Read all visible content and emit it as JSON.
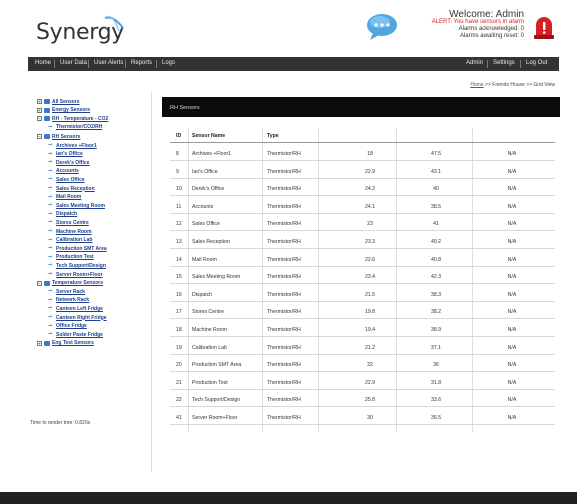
{
  "header": {
    "logo_text": "Synergy",
    "welcome": "Welcome: Admin",
    "alert": "ALERT: You have sensors in alarm",
    "alarms_ack": "Alarms acknowledged: 0",
    "alarms_waiting": "Alarms awaiting reset: 0"
  },
  "nav": {
    "left": [
      "Home",
      "User Data",
      "User Alerts",
      "Reports",
      "Logs"
    ],
    "right": [
      "Admin",
      "Settings",
      "Log Out"
    ],
    "active": "User Data"
  },
  "breadcrumb": {
    "home": "Home",
    "rest": ">> Friends House >> Grid View"
  },
  "sidebar": {
    "items": [
      {
        "label": "All Sensors",
        "level": 0,
        "kind": "box"
      },
      {
        "label": "Energy Sensors",
        "level": 0,
        "kind": "box"
      },
      {
        "label": "RH - Temperature - CO2",
        "level": 0,
        "kind": "box"
      },
      {
        "label": "Thermistor/CO2/RH",
        "level": 1,
        "kind": "sensor"
      },
      {
        "label": "RH Sensors",
        "level": 0,
        "kind": "box"
      },
      {
        "label": "Archives +Floor1",
        "level": 1,
        "kind": "sensor"
      },
      {
        "label": "Ian's Office",
        "level": 1,
        "kind": "sensor"
      },
      {
        "label": "Derek's Office",
        "level": 1,
        "kind": "sensor"
      },
      {
        "label": "Accounts",
        "level": 1,
        "kind": "sensor"
      },
      {
        "label": "Sales Office",
        "level": 1,
        "kind": "sensor"
      },
      {
        "label": "Sales Reception",
        "level": 1,
        "kind": "sensor"
      },
      {
        "label": "Mail Room",
        "level": 1,
        "kind": "sensor"
      },
      {
        "label": "Sales Meeting Room",
        "level": 1,
        "kind": "sensor"
      },
      {
        "label": "Dispatch",
        "level": 1,
        "kind": "sensor"
      },
      {
        "label": "Stores Centre",
        "level": 1,
        "kind": "sensor"
      },
      {
        "label": "Machine Room",
        "level": 1,
        "kind": "sensor"
      },
      {
        "label": "Calibration Lab",
        "level": 1,
        "kind": "sensor"
      },
      {
        "label": "Production SMT Area",
        "level": 1,
        "kind": "sensor"
      },
      {
        "label": "Production Test",
        "level": 1,
        "kind": "sensor"
      },
      {
        "label": "Tech Support/Design",
        "level": 1,
        "kind": "sensor"
      },
      {
        "label": "Server Room+Floor",
        "level": 1,
        "kind": "sensor"
      },
      {
        "label": "Temperature Sensors",
        "level": 0,
        "kind": "box"
      },
      {
        "label": "Server Rack",
        "level": 1,
        "kind": "sensor"
      },
      {
        "label": "Network Rack",
        "level": 1,
        "kind": "sensor"
      },
      {
        "label": "Canteen Left Fridge",
        "level": 1,
        "kind": "sensor"
      },
      {
        "label": "Canteen Right Fridge",
        "level": 1,
        "kind": "sensor"
      },
      {
        "label": "Office Fridge",
        "level": 1,
        "kind": "sensor"
      },
      {
        "label": "Solder Paste Fridge",
        "level": 1,
        "kind": "sensor"
      },
      {
        "label": "Eng Test Sensors",
        "level": 0,
        "kind": "box"
      }
    ],
    "time_note": "Time to render tree: 0.820s"
  },
  "panel": {
    "title": "RH Sensors",
    "columns": [
      "ID",
      "Sensor Name",
      "Type",
      "",
      "",
      ""
    ],
    "rows": [
      [
        "8",
        "Archives +Floor1",
        "Thermistor/RH",
        "18",
        "47.5",
        "N/A"
      ],
      [
        "9",
        "Ian's Office",
        "Thermistor/RH",
        "22.9",
        "43.1",
        "N/A"
      ],
      [
        "10",
        "Derek's Office",
        "Thermistor/RH",
        "24.2",
        "40",
        "N/A"
      ],
      [
        "11",
        "Accounts",
        "Thermistor/RH",
        "24.1",
        "38.5",
        "N/A"
      ],
      [
        "12",
        "Sales Office",
        "Thermistor/RH",
        "23",
        "41",
        "N/A"
      ],
      [
        "13",
        "Sales Reception",
        "Thermistor/RH",
        "23.3",
        "40.2",
        "N/A"
      ],
      [
        "14",
        "Mail Room",
        "Thermistor/RH",
        "22.6",
        "40.8",
        "N/A"
      ],
      [
        "15",
        "Sales Meeting Room",
        "Thermistor/RH",
        "23.4",
        "42.3",
        "N/A"
      ],
      [
        "16",
        "Dispatch",
        "Thermistor/RH",
        "21.5",
        "38.3",
        "N/A"
      ],
      [
        "17",
        "Stores Centre",
        "Thermistor/RH",
        "19.8",
        "38.2",
        "N/A"
      ],
      [
        "18",
        "Machine Room",
        "Thermistor/RH",
        "19.4",
        "38.9",
        "N/A"
      ],
      [
        "19",
        "Calibration Lab",
        "Thermistor/RH",
        "21.2",
        "37.1",
        "N/A"
      ],
      [
        "20",
        "Production SMT Area",
        "Thermistor/RH",
        "22",
        "36",
        "N/A"
      ],
      [
        "21",
        "Production Test",
        "Thermistor/RH",
        "22.9",
        "31.8",
        "N/A"
      ],
      [
        "22",
        "Tech Support/Design",
        "Thermistor/RH",
        "25.8",
        "33.6",
        "N/A"
      ],
      [
        "41",
        "Server Room+Floor",
        "Thermistor/RH",
        "30",
        "36.5",
        "N/A"
      ]
    ]
  },
  "colors": {
    "nav_bg": "#333333",
    "alert_red": "#d42424",
    "link_blue": "#1d3f8c",
    "panel_head": "#0b0b0b"
  },
  "icons": {
    "logo": "synergy-swoosh-icon",
    "message": "speech-bubble-icon",
    "alarm": "alarm-bell-icon"
  }
}
